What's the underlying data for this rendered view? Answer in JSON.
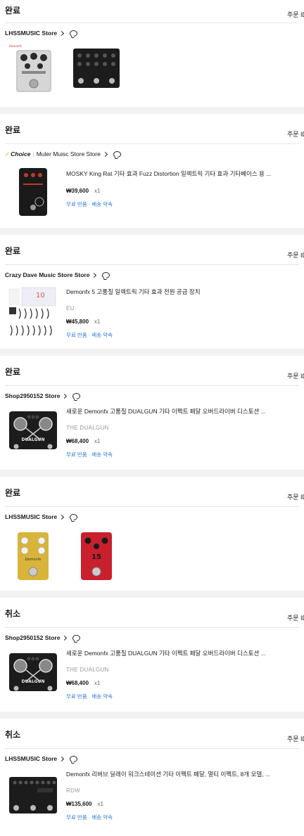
{
  "orders": [
    {
      "status": "완료",
      "order_id_label": "주문 ID",
      "store": "LHSSMUSIC Store",
      "choice": false,
      "thumbs": [
        "compressor-pedal-image",
        "multi-knob-black-pedal-image"
      ]
    },
    {
      "status": "완료",
      "order_id_label": "주문 ID",
      "store": "Muler Muisc Store Store",
      "choice": true,
      "choice_label": "Choice",
      "title": "MOSKY King Rat 기타 효과 Fuzz Distortion 일렉트릭 기타 효과 기타베이스 용 ...",
      "variant": "",
      "price": "₩39,600",
      "qty": "x1",
      "benefit": "무료 반품 · 배송 약속"
    },
    {
      "status": "완료",
      "order_id_label": "주문 ID",
      "store": "Crazy Dave Music Store Store",
      "choice": false,
      "title": "Demonfx 5 고품질 일렉트릭 기타 효과 전원 공급 장치",
      "variant": "EU",
      "price": "₩45,800",
      "qty": "x1",
      "benefit": "무료 반품 · 배송 약속"
    },
    {
      "status": "완료",
      "order_id_label": "주문 ID",
      "store": "Shop2950152 Store",
      "choice": false,
      "title": "새로운 Demonfx 고품질 DUALGUN 기타 이펙트 페달 오버드라이버 디스토션 ...",
      "variant": "THE DUALGUN",
      "price": "₩68,400",
      "qty": "x1",
      "benefit": "무료 반품 · 배송 약속"
    },
    {
      "status": "완료",
      "order_id_label": "주문 ID",
      "store": "LHSSMUSIC Store",
      "choice": false,
      "thumbs": [
        "yellow-pedal-image",
        "red-pedal-image"
      ]
    },
    {
      "status": "취소",
      "order_id_label": "주문 ID",
      "store": "Shop2950152 Store",
      "choice": false,
      "title": "새로운 Demonfx 고품질 DUALGUN 기타 이펙트 페달 오버드라이버 디스토션 ...",
      "variant": "THE DUALGUN",
      "price": "₩68,400",
      "qty": "x1",
      "benefit": "무료 반품 · 배송 약속"
    },
    {
      "status": "취소",
      "order_id_label": "주문 ID",
      "store": "LHSSMUSIC Store",
      "choice": false,
      "title": "Demonfx 리버브 딜레이 워크스테이션 기타 이펙트 페달, 멀티 이펙트, 8개 모델, ...",
      "variant": "RDW",
      "price": "₩135,600",
      "qty": "x1",
      "benefit": "무료 반품 · 배송 약속"
    }
  ],
  "colors": {
    "benefit": "#2e7bd6",
    "choice_tick": "#f2a900",
    "background": "#f2f2f2"
  }
}
